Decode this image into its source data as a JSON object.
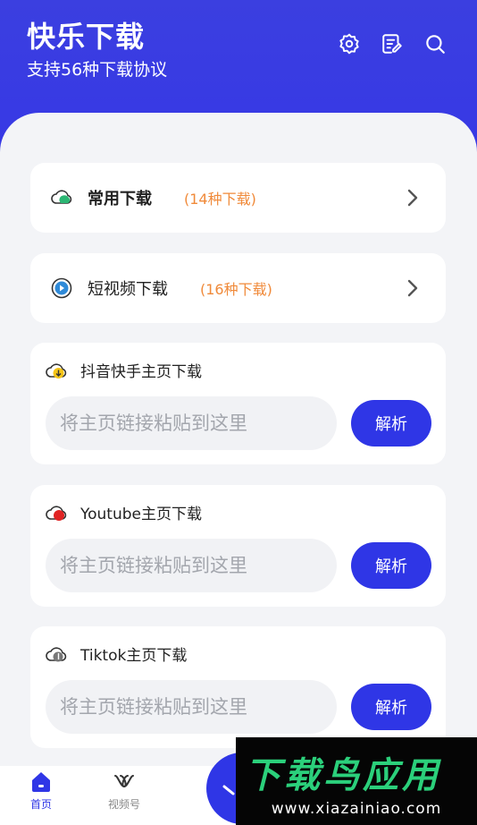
{
  "header": {
    "title": "快乐下载",
    "subtitle": "支持56种下载协议",
    "icons": [
      "settings-icon",
      "edit-icon",
      "search-icon"
    ]
  },
  "categories": [
    {
      "label": "常用下载",
      "count": "(14种下载)",
      "icon": "cloud-icon"
    },
    {
      "label": "短视频下载",
      "count": "(16种下载)",
      "icon": "play-icon"
    }
  ],
  "sections": [
    {
      "title": "抖音快手主页下载",
      "placeholder": "将主页链接粘贴到这里",
      "button": "解析",
      "accent": "#f5c518"
    },
    {
      "title": "Youtube主页下载",
      "placeholder": "将主页链接粘贴到这里",
      "button": "解析",
      "accent": "#e02424"
    },
    {
      "title": "Tiktok主页下载",
      "placeholder": "将主页链接粘贴到这里",
      "button": "解析",
      "accent": "#777777"
    }
  ],
  "tabbar": {
    "items": [
      {
        "label": "首页",
        "icon": "home-icon",
        "active": true
      },
      {
        "label": "视频号",
        "icon": "channels-icon",
        "active": false
      }
    ]
  },
  "watermark": {
    "title": "下载鸟应用",
    "url": "www.xiazainiao.com"
  },
  "colors": {
    "primary": "#2f36e6",
    "count": "#f08a3a",
    "background": "#f3f4f7"
  }
}
